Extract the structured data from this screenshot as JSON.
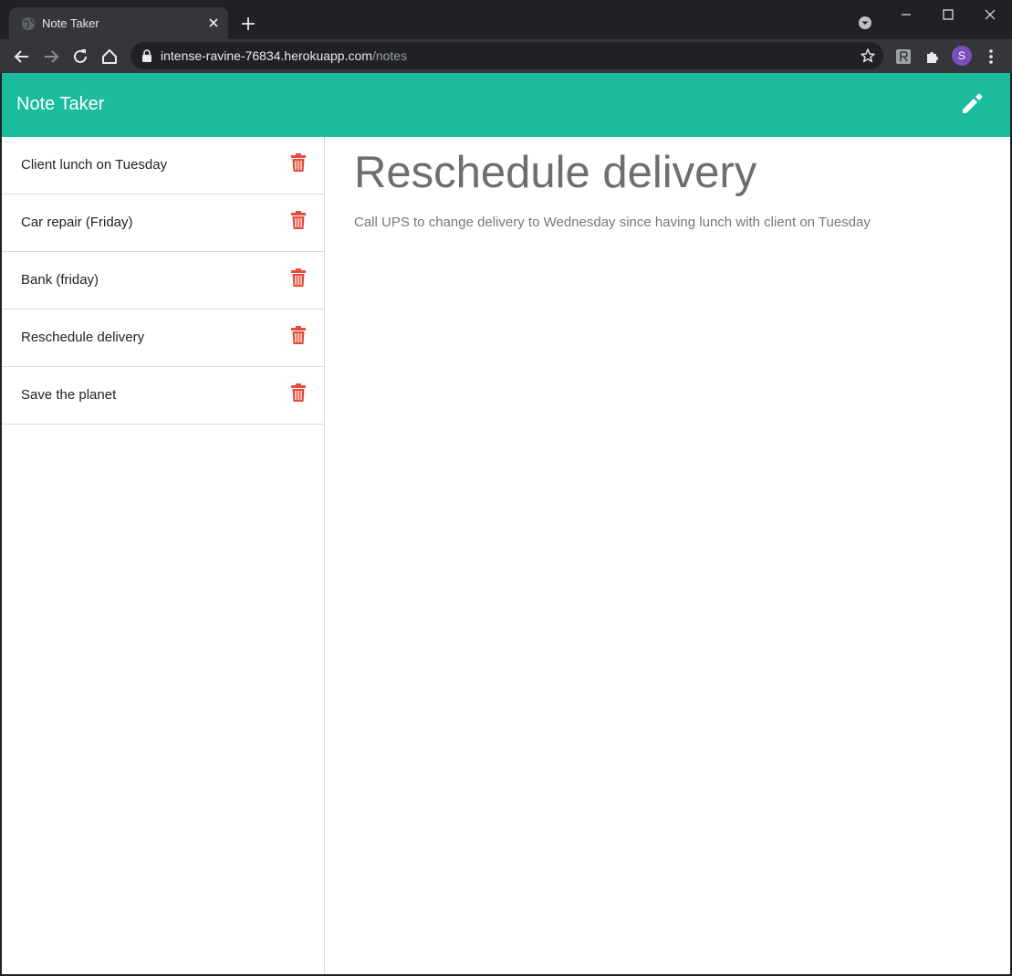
{
  "browser": {
    "tab_title": "Note Taker",
    "url_host": "intense-ravine-76834.herokuapp.com",
    "url_path": "/notes",
    "profile_initial": "S"
  },
  "app": {
    "brand": "Note Taker",
    "accent_color": "#1abc9c",
    "delete_color": "#e74c3c"
  },
  "notes": [
    {
      "title": "Client lunch on Tuesday"
    },
    {
      "title": "Car repair (Friday)"
    },
    {
      "title": "Bank (friday)"
    },
    {
      "title": "Reschedule delivery"
    },
    {
      "title": "Save the planet"
    }
  ],
  "active_note": {
    "title": "Reschedule delivery",
    "text": "Call UPS to change delivery to Wednesday since having lunch with client on Tuesday"
  }
}
